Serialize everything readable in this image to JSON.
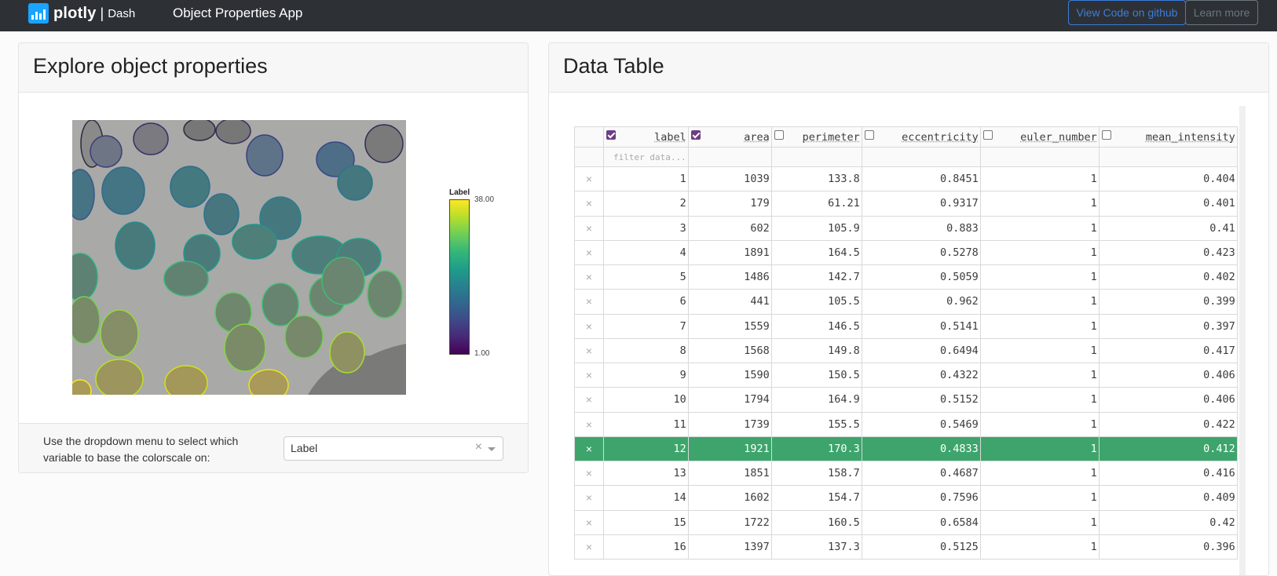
{
  "navbar": {
    "logo_text": "plotly",
    "logo_sep": "|",
    "logo_product": "Dash",
    "app_title": "Object Properties App",
    "github_button": "View Code on github",
    "learn_button": "Learn more"
  },
  "left": {
    "title": "Explore object properties",
    "colorbar": {
      "title": "Label",
      "max": "38.00",
      "min": "1.00"
    },
    "footer_text": "Use the dropdown menu to select which variable to base the colorscale on:",
    "dropdown": {
      "value": "Label",
      "clear_glyph": "×"
    }
  },
  "right": {
    "title": "Data Table",
    "filter_placeholder": "filter data...",
    "columns": [
      {
        "label": "label",
        "checked": true
      },
      {
        "label": "area",
        "checked": true
      },
      {
        "label": "perimeter",
        "checked": false
      },
      {
        "label": "eccentricity",
        "checked": false
      },
      {
        "label": "euler_number",
        "checked": false
      },
      {
        "label": "mean_intensity",
        "checked": false
      }
    ],
    "selected_row_label": "12",
    "delete_glyph": "×",
    "rows": [
      [
        "1",
        "1039",
        "133.8",
        "0.8451",
        "1",
        "0.404"
      ],
      [
        "2",
        "179",
        "61.21",
        "0.9317",
        "1",
        "0.401"
      ],
      [
        "3",
        "602",
        "105.9",
        "0.883",
        "1",
        "0.41"
      ],
      [
        "4",
        "1891",
        "164.5",
        "0.5278",
        "1",
        "0.423"
      ],
      [
        "5",
        "1486",
        "142.7",
        "0.5059",
        "1",
        "0.402"
      ],
      [
        "6",
        "441",
        "105.5",
        "0.962",
        "1",
        "0.399"
      ],
      [
        "7",
        "1559",
        "146.5",
        "0.5141",
        "1",
        "0.397"
      ],
      [
        "8",
        "1568",
        "149.8",
        "0.6494",
        "1",
        "0.417"
      ],
      [
        "9",
        "1590",
        "150.5",
        "0.4322",
        "1",
        "0.406"
      ],
      [
        "10",
        "1794",
        "164.9",
        "0.5152",
        "1",
        "0.406"
      ],
      [
        "11",
        "1739",
        "155.5",
        "0.5469",
        "1",
        "0.422"
      ],
      [
        "12",
        "1921",
        "170.3",
        "0.4833",
        "1",
        "0.412"
      ],
      [
        "13",
        "1851",
        "158.7",
        "0.4687",
        "1",
        "0.416"
      ],
      [
        "14",
        "1602",
        "154.7",
        "0.7596",
        "1",
        "0.409"
      ],
      [
        "15",
        "1722",
        "160.5",
        "0.6584",
        "1",
        "0.42"
      ],
      [
        "16",
        "1397",
        "137.3",
        "0.5125",
        "1",
        "0.396"
      ]
    ]
  }
}
